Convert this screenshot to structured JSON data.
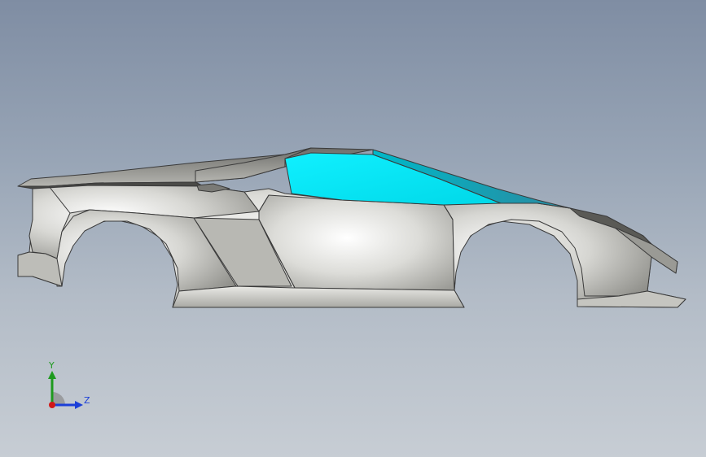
{
  "viewport": {
    "background_top": "#7f8da3",
    "background_bottom": "#c7cdd4"
  },
  "model": {
    "name": "sports-car-body",
    "body_color": "#d2d2cf",
    "glass_color": "#00e8f0",
    "edge_color": "#3a3a3a"
  },
  "triad": {
    "y_label": "Y",
    "z_label": "Z",
    "y_color": "#1e9a1e",
    "z_color": "#1b3fd8",
    "x_color": "#d01818"
  }
}
